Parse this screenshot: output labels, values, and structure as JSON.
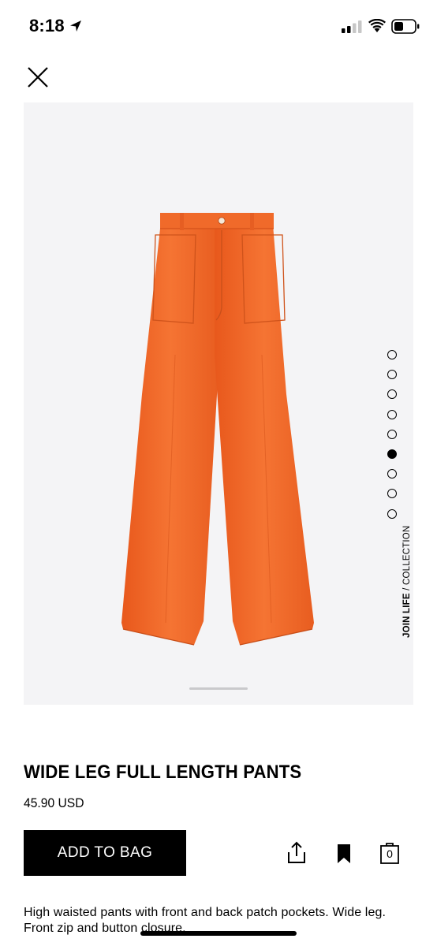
{
  "status_bar": {
    "time": "8:18"
  },
  "product": {
    "collection_bold": "JOIN LIFE",
    "collection_rest": " / COLLECTION",
    "title": "WIDE LEG FULL LENGTH PANTS",
    "price": "45.90 USD",
    "description": "High waisted pants with front and back patch pockets. Wide leg. Front zip and button closure.",
    "image_colors": {
      "fabric": "#f26a2a",
      "background": "#f4f4f6"
    }
  },
  "gallery": {
    "image_count": 9,
    "active_index": 5
  },
  "actions": {
    "add_to_bag_label": "ADD TO BAG",
    "bag_count": "0"
  },
  "icons": [
    "location-arrow-icon",
    "signal-icon",
    "wifi-icon",
    "battery-icon",
    "close-icon",
    "share-icon",
    "bookmark-icon",
    "bag-icon"
  ]
}
